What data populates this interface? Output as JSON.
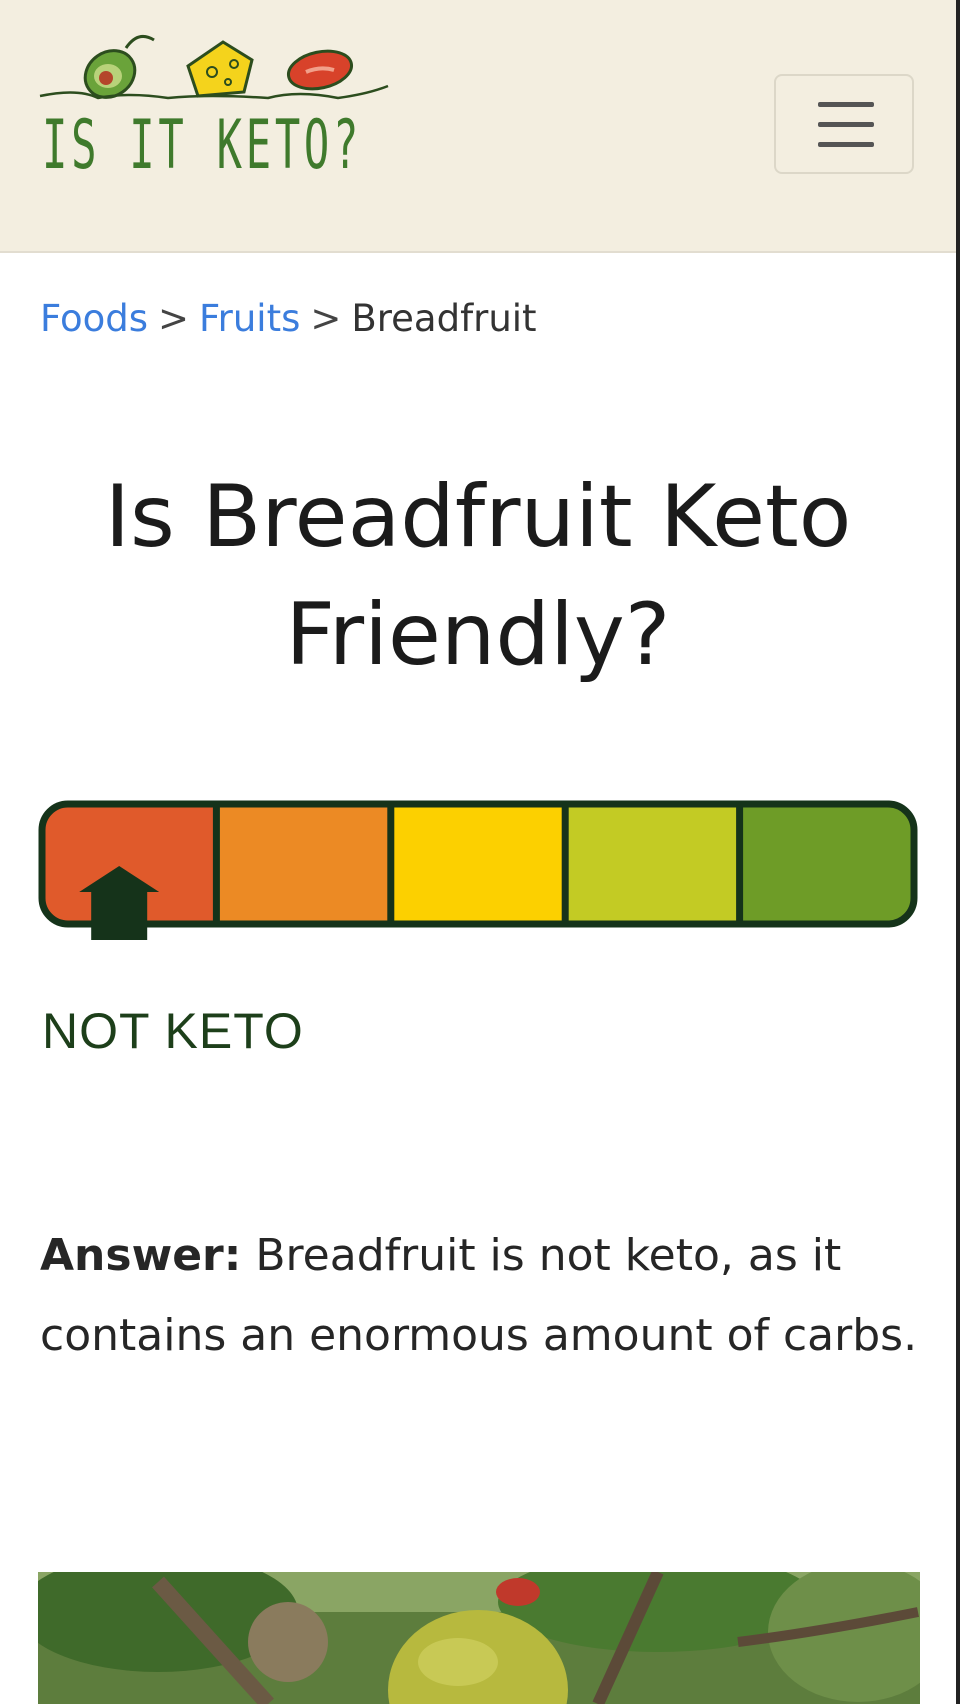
{
  "header": {
    "logo_text": "IS IT KETO?",
    "menu_icon": "hamburger-menu-icon"
  },
  "breadcrumb": {
    "items": [
      {
        "label": "Foods"
      },
      {
        "label": "Fruits"
      },
      {
        "label": "Breadfruit"
      }
    ],
    "separator": ">"
  },
  "main": {
    "title": "Is Breadfruit Keto Friendly?",
    "meter": {
      "level": 1,
      "levels_total": 5,
      "colors": [
        "#e05a2b",
        "#ec8a24",
        "#fcd000",
        "#c3cb24",
        "#6e9c27"
      ],
      "outline_color": "#15331a",
      "verdict": "NOT KETO"
    },
    "answer": {
      "label": "Answer:",
      "text": "Breadfruit is not keto, as it contains an enormous amount of carbs."
    }
  },
  "colors": {
    "header_bg": "#f3eee0",
    "link": "#3b7ddd",
    "logo_green": "#3f7a2c"
  }
}
